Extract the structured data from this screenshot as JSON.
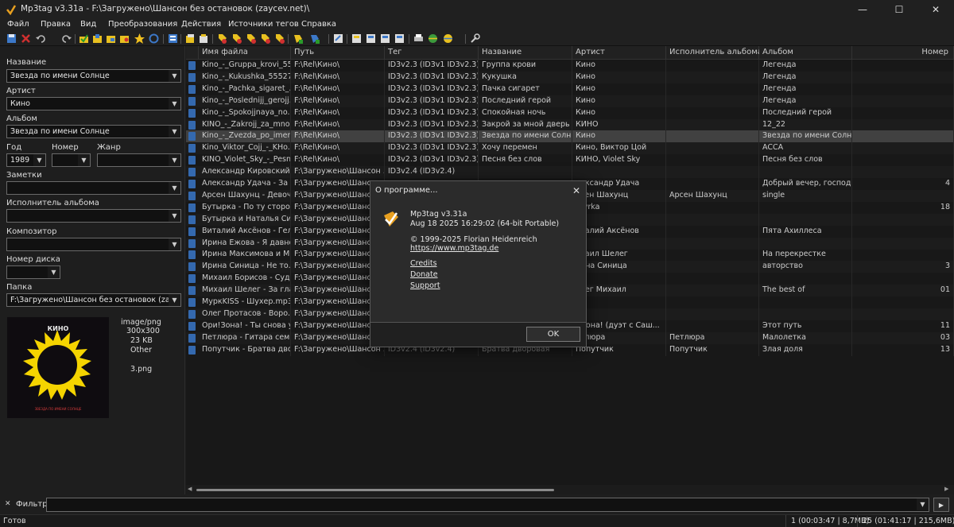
{
  "window": {
    "title": "Mp3tag v3.31a   -   F:\\Загружено\\Шансон без остановок (zaycev.net)\\",
    "minimize_glyph": "—",
    "maximize_glyph": "☐",
    "close_glyph": "✕"
  },
  "menu": [
    "Файл",
    "Правка",
    "Вид",
    "Преобразования",
    "Действия",
    "Источники тегов",
    "Справка"
  ],
  "left_panel": {
    "title_label": "Название",
    "title_value": "Звезда по имени Солнце",
    "artist_label": "Артист",
    "artist_value": "Кино",
    "album_label": "Альбом",
    "album_value": "Звезда по имени Солнце",
    "year_label": "Год",
    "year_value": "1989",
    "track_label": "Номер",
    "track_value": "",
    "genre_label": "Жанр",
    "genre_value": "",
    "comment_label": "Заметки",
    "comment_value": "",
    "albumartist_label": "Исполнитель альбома",
    "albumartist_value": "",
    "composer_label": "Композитор",
    "composer_value": "",
    "disc_label": "Номер диска",
    "disc_value": "",
    "folder_label": "Папка",
    "folder_value": "F:\\Загружено\\Шансон без остановок (zaycev.net)\\",
    "cover": {
      "band_logo": "КИНО",
      "caption": "ЗВЕЗДА ПО ИМЕНИ СОЛНЦЕ",
      "sun_color": "#f5d400",
      "caption_color": "#d23a3a"
    },
    "cover_info": {
      "mime": "image/png",
      "dimensions": "300x300",
      "size": "23 KB",
      "type": "Other",
      "filename": "3.png"
    }
  },
  "grid": {
    "columns": [
      "Имя файла",
      "Путь",
      "Тег",
      "Название",
      "Артист",
      "Исполнитель альбома",
      "Альбом",
      "Номер"
    ],
    "rows": [
      [
        "Kino_-_Gruppa_krovi_55...",
        "F:\\Rel\\Кино\\",
        "ID3v2.3 (ID3v1 ID3v2.3)",
        "Группа крови",
        "Кино",
        "",
        "Легенда",
        ""
      ],
      [
        "Kino_-_Kukushka_55527...",
        "F:\\Rel\\Кино\\",
        "ID3v2.3 (ID3v1 ID3v2.3)",
        "Кукушка",
        "Кино",
        "",
        "Легенда",
        ""
      ],
      [
        "Kino_-_Pachka_sigaret_...",
        "F:\\Rel\\Кино\\",
        "ID3v2.3 (ID3v1 ID3v2.3)",
        "Пачка сигарет",
        "Кино",
        "",
        "Легенда",
        ""
      ],
      [
        "Kino_-_Poslednijj_gerojj...",
        "F:\\Rel\\Кино\\",
        "ID3v2.3 (ID3v1 ID3v2.3)",
        "Последний герой",
        "Кино",
        "",
        "Легенда",
        ""
      ],
      [
        "Kino_-_Spokojjnaya_no...",
        "F:\\Rel\\Кино\\",
        "ID3v2.3 (ID3v1 ID3v2.3)",
        "Спокойная ночь",
        "Кино",
        "",
        "Последний герой",
        ""
      ],
      [
        "KINO_-_Zakrojj_za_mno...",
        "F:\\Rel\\Кино\\",
        "ID3v2.3 (ID3v1 ID3v2.3)",
        "Закрой за мной дверь",
        "КИНО",
        "",
        "12_22",
        ""
      ],
      [
        "Kino_-_Zvezda_po_imen...",
        "F:\\Rel\\Кино\\",
        "ID3v2.3 (ID3v1 ID3v2.3)",
        "Звезда по имени Солн...",
        "Кино",
        "",
        "Звезда по имени Солн...",
        ""
      ],
      [
        "Kino_Viktor_Cojj_-_KHo...",
        "F:\\Rel\\Кино\\",
        "ID3v2.3 (ID3v1 ID3v2.3)",
        "Хочу перемен",
        "Кино, Виктор Цой",
        "",
        "ACCA",
        ""
      ],
      [
        "KINO_Violet_Sky_-_Pesn...",
        "F:\\Rel\\Кино\\",
        "ID3v2.3 (ID3v1 ID3v2.3)",
        "Песня без слов",
        "КИНО, Violet Sky",
        "",
        "Песня без слов",
        ""
      ],
      [
        "Александр Кировский ...",
        "F:\\Загружено\\Шансон ...",
        "ID3v2.4 (ID3v2.4)",
        "",
        "",
        "",
        "",
        ""
      ],
      [
        "Александр Удача - За д...",
        "F:\\Загружено\\Шансон ...",
        "",
        "",
        "лександр Удача",
        "",
        "Добрый вечер, господа",
        "4"
      ],
      [
        "Арсен Шахунц - Девоч...",
        "F:\\Загружено\\Шансон ...",
        "",
        "",
        "рсен Шахунц",
        "Арсен Шахунц",
        "single",
        ""
      ],
      [
        "Бутырка - По ту сторо...",
        "F:\\Загружено\\Шансон ...",
        "",
        "",
        "utyrka",
        "",
        "",
        "18"
      ],
      [
        "Бутырка и Наталья Сиг...",
        "F:\\Загружено\\Шансон ...",
        "",
        "",
        "",
        "",
        "",
        ""
      ],
      [
        "Виталий Аксёнов - Гел...",
        "F:\\Загружено\\Шансон ...",
        "",
        "",
        "италий Аксёнов",
        "",
        "Пята Ахиллеса",
        ""
      ],
      [
        "Ирина Ежова - Я давно...",
        "F:\\Загружено\\Шансон ...",
        "",
        "",
        "",
        "",
        "",
        ""
      ],
      [
        "Ирина Максимова и М...",
        "F:\\Загружено\\Шансон ...",
        "",
        "",
        "ихаил Шелег",
        "",
        "На перекрестке",
        ""
      ],
      [
        "Ирина Синица - Не то...",
        "F:\\Загружено\\Шансон ...",
        "",
        "",
        "рина Синица",
        "",
        "авторство",
        "3"
      ],
      [
        "Михаил Борисов - Суд...",
        "F:\\Загружено\\Шансон ...",
        "",
        "",
        "",
        "",
        "",
        ""
      ],
      [
        "Михаил Шелег - За гла...",
        "F:\\Загружено\\Шансон ...",
        "",
        "",
        "елег Михаил",
        "",
        "The best of",
        "01"
      ],
      [
        "МуркKISS - Шухер.mp3",
        "F:\\Загружено\\Шансон ...",
        "",
        "",
        "",
        "",
        "",
        ""
      ],
      [
        "Олег Протасов - Воро...",
        "F:\\Загружено\\Шансон ...",
        "",
        "",
        "",
        "",
        "",
        ""
      ],
      [
        "Ори!Зона! - Ты снова у...",
        "F:\\Загружено\\Шансон ...",
        "",
        "",
        "! Зона! (дуэт с Саш...",
        "",
        "Этот путь",
        "11"
      ],
      [
        "Петлюра - Гитара сем...",
        "F:\\Загружено\\Шансон ...",
        "",
        "",
        "етлюра",
        "Петлюра",
        "Малолетка",
        "03"
      ],
      [
        "Попутчик - Братва дво...",
        "F:\\Загружено\\Шансон ...",
        "ID3v2.4 (ID3v2.4)",
        "Братва дворовая",
        "Попутчик",
        "Попутчик",
        "Злая доля",
        "13"
      ]
    ],
    "selected_row": 6
  },
  "filter": {
    "label": "Фильтр:",
    "value": ""
  },
  "status": {
    "left": "Готов",
    "selection": "1 (00:03:47 | 8,7MB)",
    "total": "25 (01:41:17 | 215,6MB)"
  },
  "dialog": {
    "title": "О программе...",
    "app_version": "Mp3tag v3.31a",
    "build": "Aug 18 2025 16:29:02 (64-bit Portable)",
    "copyright": "© 1999-2025 Florian Heidenreich",
    "website": "https://www.mp3tag.de",
    "links": [
      "Credits",
      "Donate",
      "Support"
    ],
    "ok_label": "OK"
  },
  "colors": {
    "accent_blue": "#3c78c8",
    "toolbar_yellow": "#e8c020",
    "selection": "#4a4a4a"
  }
}
